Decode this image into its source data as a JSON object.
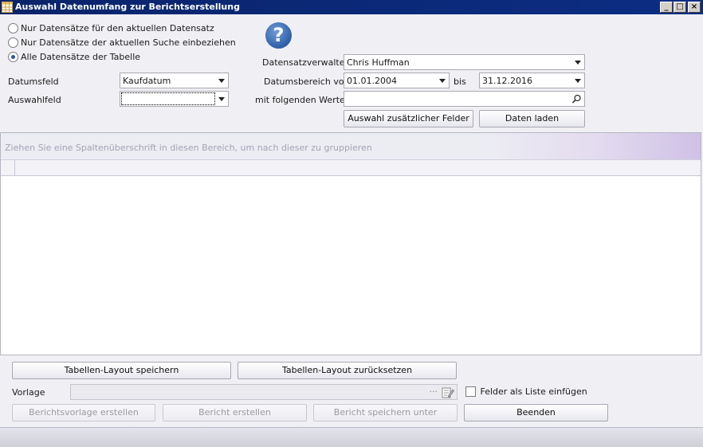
{
  "window": {
    "title": "Auswahl Datenumfang zur Berichtserstellung",
    "controls": {
      "minimize": "_",
      "maximize": "□",
      "close": "×"
    }
  },
  "scope": {
    "options": [
      {
        "label": "Nur Datensätze für den aktuellen Datensatz",
        "selected": false
      },
      {
        "label": "Nur Datensätze der aktuellen Suche einbeziehen",
        "selected": false
      },
      {
        "label": "Alle Datensätze der Tabelle",
        "selected": true
      }
    ]
  },
  "fields": {
    "datumsfeld_label": "Datumsfeld",
    "datumsfeld_value": "Kaufdatum",
    "auswahlfeld_label": "Auswahlfeld",
    "auswahlfeld_value": "",
    "verwalter_label": "Datensatzverwalter",
    "verwalter_value": "Chris Huffman",
    "datumsbereich_label": "Datumsbereich von",
    "date_from": "01.01.2004",
    "bis_label": "bis",
    "date_to": "31.12.2016",
    "werte_label": "mit folgenden Werten",
    "werte_value": ""
  },
  "buttons": {
    "zusatz": "Auswahl zusätzlicher Felder",
    "laden": "Daten laden",
    "layout_save": "Tabellen-Layout speichern",
    "layout_reset": "Tabellen-Layout zurücksetzen",
    "vorlage_create": "Berichtsvorlage erstellen",
    "bericht_create": "Bericht erstellen",
    "bericht_save": "Bericht speichern unter",
    "beenden": "Beenden"
  },
  "grid": {
    "group_hint": "Ziehen Sie eine Spaltenüberschrift in diesen Bereich, um nach dieser zu gruppieren"
  },
  "vorlage": {
    "label": "Vorlage",
    "value": "",
    "ellipsis": "···",
    "checkbox_label": "Felder als Liste einfügen",
    "checkbox_checked": false
  },
  "icons": {
    "help": "?",
    "search": "search-icon",
    "edit": "edit-icon",
    "app": "table-icon"
  }
}
